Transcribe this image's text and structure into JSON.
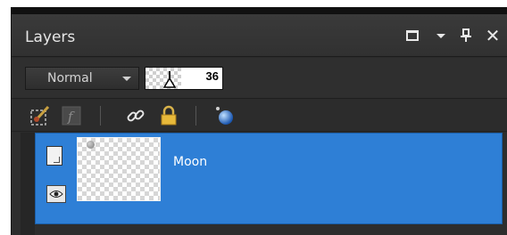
{
  "panel": {
    "title": "Layers",
    "window_controls": [
      "restore-icon",
      "menu-dropdown-icon",
      "pin-icon",
      "close-icon"
    ],
    "close_glyph": "✕"
  },
  "blend": {
    "mode": "Normal",
    "opacity": "36"
  },
  "toolbar": {
    "icons": [
      "brush-mask-icon",
      "fx-effects-icon",
      "link-icon",
      "lock-icon",
      "sphere-icon"
    ]
  },
  "layers": [
    {
      "name": "Moon",
      "selected": true,
      "visible": true,
      "type_icon": "page-layer-icon",
      "visibility_icon": "eye-icon"
    }
  ],
  "colors": {
    "panel_bg": "#2b2b2b",
    "selection": "#2e7fd6",
    "text": "#e6e6e6"
  }
}
